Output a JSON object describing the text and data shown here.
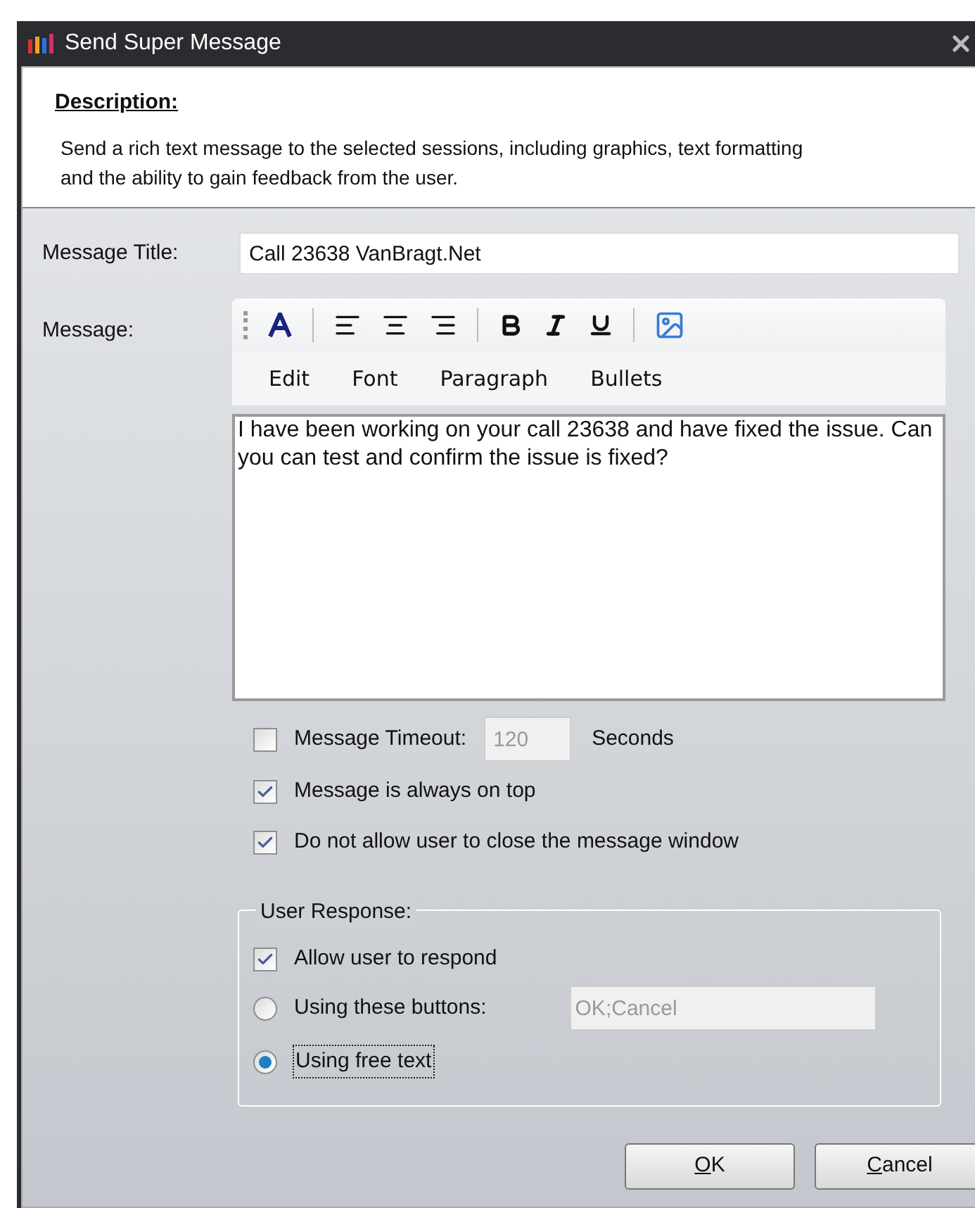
{
  "window": {
    "title": "Send Super Message"
  },
  "description": {
    "heading": "Description:",
    "text": "Send a rich text message to the selected sessions, including graphics, text formatting and the ability to gain feedback from the user."
  },
  "message_title": {
    "label": "Message Title:",
    "value": "Call 23638 VanBragt.Net"
  },
  "message": {
    "label": "Message:",
    "menus": [
      "Edit",
      "Font",
      "Paragraph",
      "Bullets"
    ],
    "body": "I have been working on your call 23638 and have fixed the issue. Can you can test and confirm the issue is fixed?"
  },
  "timeout": {
    "label": "Message Timeout:",
    "checked": false,
    "value": "120",
    "unit": "Seconds"
  },
  "options": [
    {
      "label": "Message is always on top",
      "checked": true
    },
    {
      "label": "Do not allow user to close the message window",
      "checked": true
    }
  ],
  "user_response": {
    "title": "User Response:",
    "allow": {
      "label": "Allow user to respond",
      "checked": true
    },
    "choices": [
      {
        "kind": "buttons",
        "label": "Using these buttons:",
        "selected": false,
        "value": "OK;Cancel"
      },
      {
        "kind": "free",
        "label": "Using free text",
        "selected": true
      }
    ]
  },
  "buttons": [
    {
      "label": "OK"
    },
    {
      "label": "Cancel"
    }
  ]
}
